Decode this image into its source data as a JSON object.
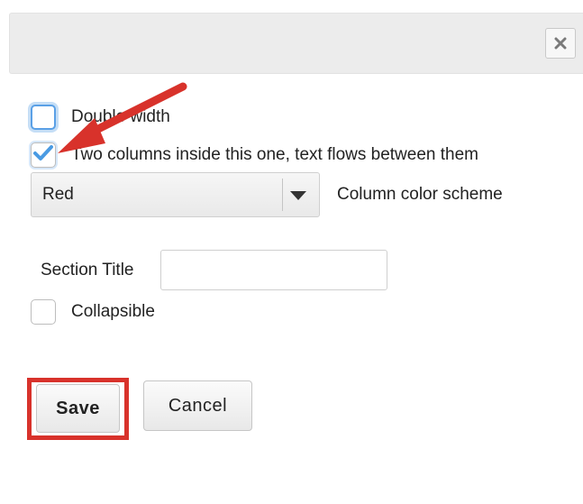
{
  "dialog": {
    "close_label": "×"
  },
  "options": {
    "double_width": {
      "label": "Double width",
      "checked": false
    },
    "two_columns": {
      "label": "Two columns inside this one, text flows between them",
      "checked": true
    }
  },
  "color_scheme": {
    "selected": "Red",
    "caption": "Column color scheme"
  },
  "section_title": {
    "label": "Section Title",
    "value": "",
    "placeholder": ""
  },
  "collapsible": {
    "label": "Collapsible",
    "checked": false
  },
  "actions": {
    "save_label": "Save",
    "cancel_label": "Cancel"
  },
  "annotations": {
    "arrow_color": "#d8322b",
    "highlight_color": "#d8322b"
  },
  "colors": {
    "checkbox_accent": "#4a9be3",
    "header_bg": "#ececec"
  }
}
